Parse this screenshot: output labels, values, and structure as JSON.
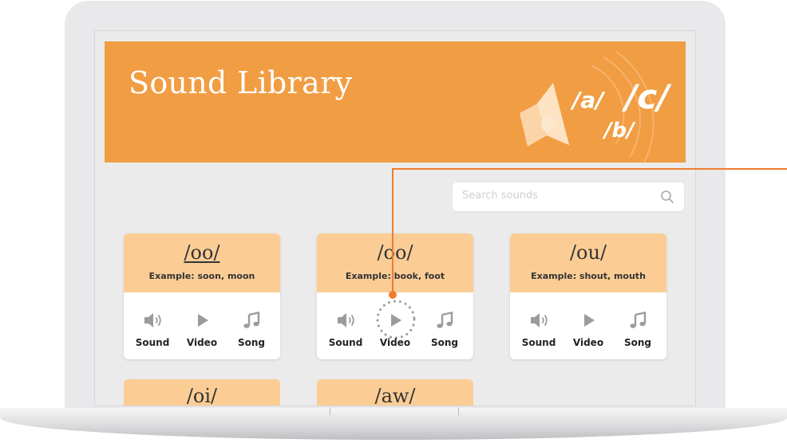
{
  "banner": {
    "title": "Sound Library",
    "phonemes": [
      "/a/",
      "/c/",
      "/b/"
    ]
  },
  "search": {
    "placeholder": "Search sounds"
  },
  "cards": [
    {
      "sound": "/oo/",
      "underline": true,
      "example": "Example: soon, moon"
    },
    {
      "sound": "/oo/",
      "underline": false,
      "example": "Example: book, foot"
    },
    {
      "sound": "/ou/",
      "underline": false,
      "example": "Example: shout, mouth"
    }
  ],
  "actions": {
    "sound": "Sound",
    "video": "Video",
    "song": "Song"
  },
  "partial_cards": [
    {
      "sound": "/oi/"
    },
    {
      "sound": "/aw/"
    }
  ],
  "colors": {
    "banner": "#f19d43",
    "card_header": "#fbcd95",
    "callout": "#ef7d2e",
    "icon": "#9b9b9b"
  },
  "icons": [
    "speaker-icon",
    "play-icon",
    "music-note-icon",
    "search-icon"
  ]
}
